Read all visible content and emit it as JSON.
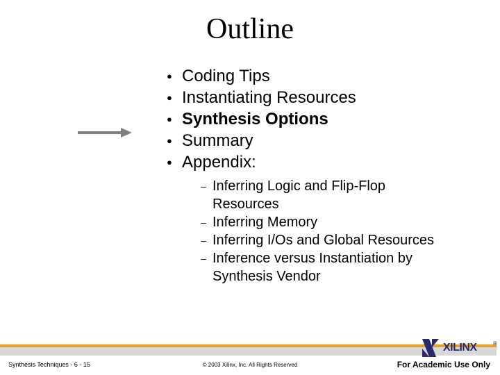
{
  "title": "Outline",
  "bullets": [
    {
      "text": "Coding Tips",
      "bold": false
    },
    {
      "text": "Instantiating Resources",
      "bold": false
    },
    {
      "text": "Synthesis Options",
      "bold": true
    },
    {
      "text": "Summary",
      "bold": false
    },
    {
      "text": "Appendix:",
      "bold": false
    }
  ],
  "sub_bullets": [
    "Inferring Logic and Flip-Flop Resources",
    "Inferring Memory",
    "Inferring I/Os and Global Resources",
    "Inference versus Instantiation by Synthesis Vendor"
  ],
  "footer": {
    "left": "Synthesis Techniques  -  6  -  15",
    "center": "© 2003 Xilinx, Inc. All Rights Reserved",
    "right": "For Academic Use Only"
  },
  "logo_text": "XILINX",
  "logo_r": "®"
}
